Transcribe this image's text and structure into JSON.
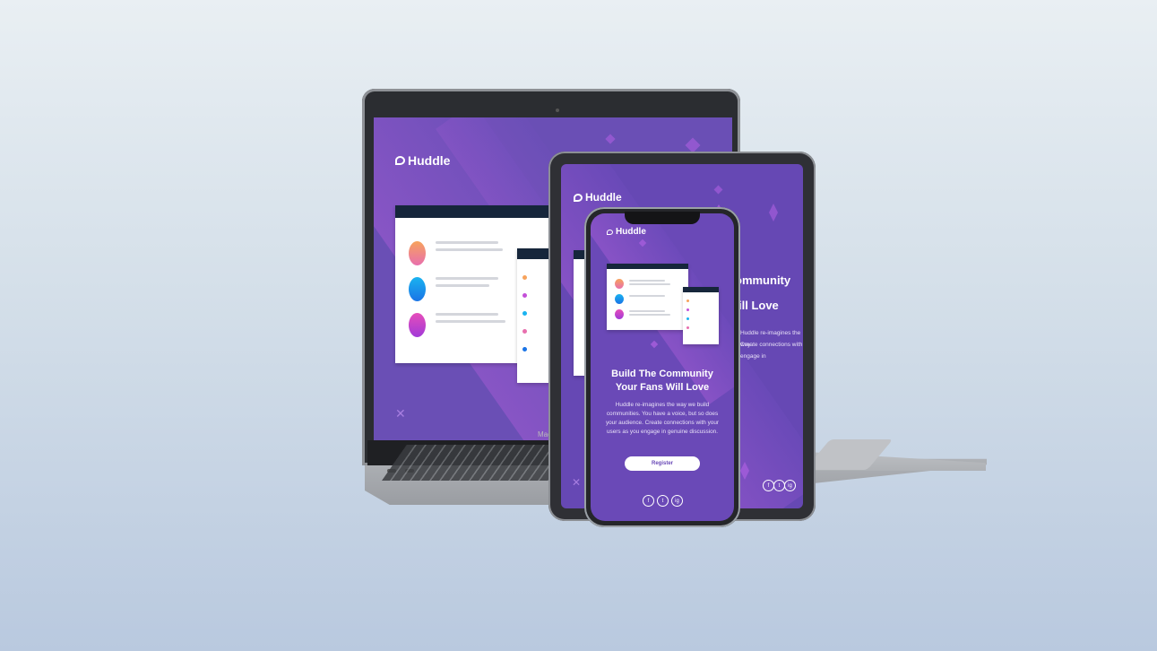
{
  "laptop": {
    "brand_text": "MacBook Air",
    "logo_text": "Huddle"
  },
  "tablet": {
    "logo_text": "Huddle",
    "headline_line1": "ommunity",
    "headline_line2": "ill Love",
    "desc_lines": [
      "Huddle re-imagines the way",
      "Create connections with",
      "engage in"
    ],
    "social_icons": [
      "f",
      "t",
      "ig"
    ]
  },
  "phone": {
    "logo_text": "Huddle",
    "headline": "Build The Community Your Fans Will Love",
    "description": "Huddle re-imagines the way we build communities. You have a voice, but so does your audience. Create connections with your users as you engage in genuine discussion.",
    "cta_label": "Register",
    "social_icons": [
      "f",
      "t",
      "ig"
    ]
  },
  "colors": {
    "brand_purple": "#6a49b7",
    "accent_pink": "#c450d8",
    "dark_navy": "#16263b"
  }
}
